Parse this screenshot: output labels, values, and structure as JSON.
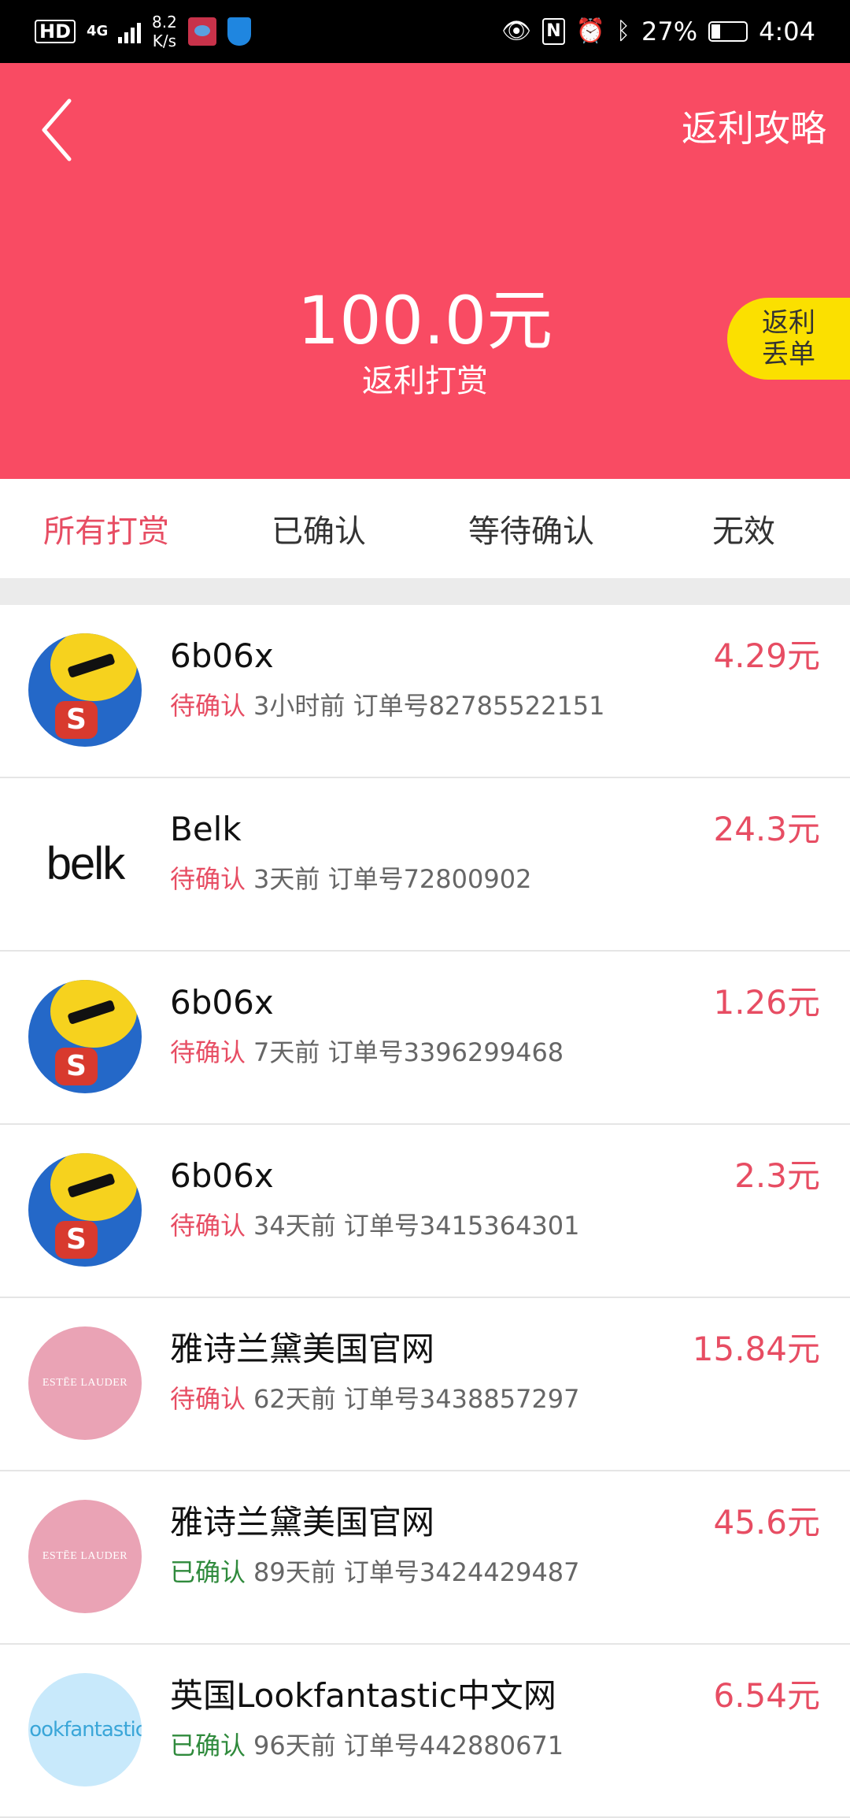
{
  "status_bar": {
    "hd": "HD",
    "network": "4G",
    "speed_value": "8.2",
    "speed_unit": "K/s",
    "battery": "27%",
    "battery_level": 0.27,
    "time": "4:04"
  },
  "header": {
    "guide_link": "返利攻略",
    "total_amount": "100.0元",
    "total_label": "返利打赏",
    "lost_button": [
      "返利",
      "丢单"
    ],
    "background_color": "#f94b63",
    "lost_button_color": "#fbe000"
  },
  "tabs": [
    {
      "label": "所有打赏",
      "active": true
    },
    {
      "label": "已确认",
      "active": false
    },
    {
      "label": "等待确认",
      "active": false
    },
    {
      "label": "无效",
      "active": false
    }
  ],
  "list": [
    {
      "avatar": "duck",
      "store": "6b06x",
      "status": "待确认",
      "status_type": "pending",
      "time_ago": "3小时前",
      "order": "订单号82785522151",
      "amount": "4.29元"
    },
    {
      "avatar": "belk",
      "avatar_text": "belk",
      "store": "Belk",
      "status": "待确认",
      "status_type": "pending",
      "time_ago": "3天前",
      "order": "订单号72800902",
      "amount": "24.3元"
    },
    {
      "avatar": "duck",
      "store": "6b06x",
      "status": "待确认",
      "status_type": "pending",
      "time_ago": "7天前",
      "order": "订单号3396299468",
      "amount": "1.26元"
    },
    {
      "avatar": "duck",
      "store": "6b06x",
      "status": "待确认",
      "status_type": "pending",
      "time_ago": "34天前",
      "order": "订单号3415364301",
      "amount": "2.3元"
    },
    {
      "avatar": "estee",
      "avatar_text": "ESTĒE LAUDER",
      "store": "雅诗兰黛美国官网",
      "status": "待确认",
      "status_type": "pending",
      "time_ago": "62天前",
      "order": "订单号3438857297",
      "amount": "15.84元"
    },
    {
      "avatar": "estee",
      "avatar_text": "ESTĒE LAUDER",
      "store": "雅诗兰黛美国官网",
      "status": "已确认",
      "status_type": "confirmed",
      "time_ago": "89天前",
      "order": "订单号3424429487",
      "amount": "45.6元"
    },
    {
      "avatar": "lookfantastic",
      "avatar_text": "lookfantastic",
      "store": "英国Lookfantastic中文网",
      "status": "已确认",
      "status_type": "confirmed",
      "time_ago": "96天前",
      "order": "订单号442880671",
      "amount": "6.54元"
    }
  ]
}
